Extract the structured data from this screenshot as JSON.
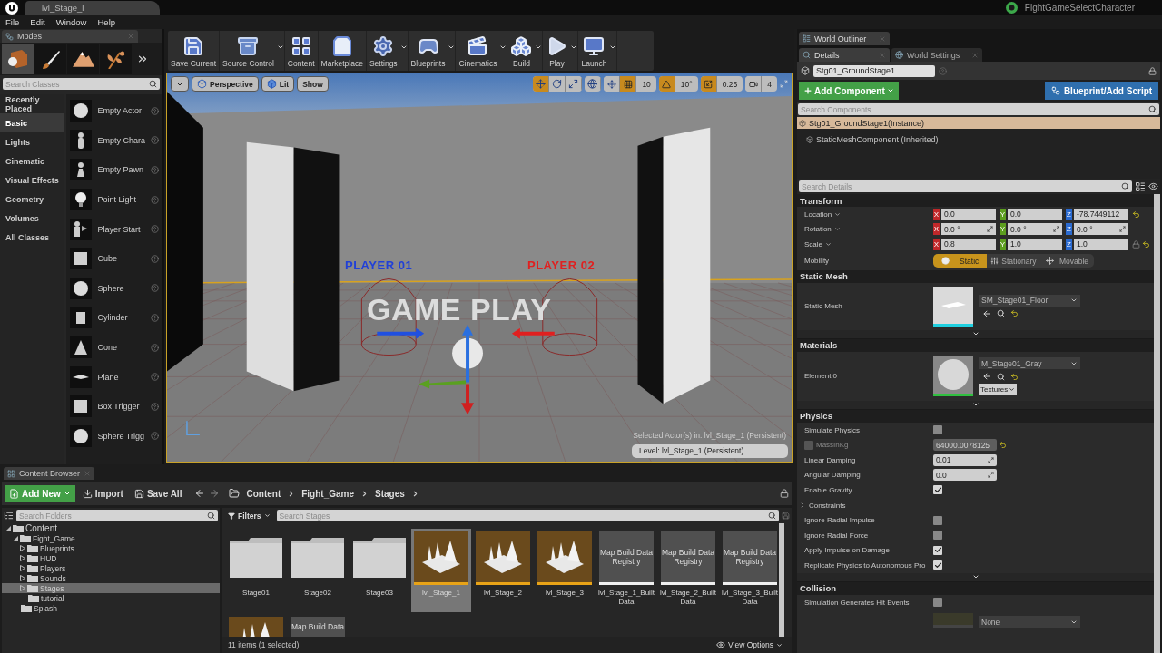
{
  "title_bar": {
    "document_tab": "lvl_Stage_l",
    "project": "FightGameSelectCharacter"
  },
  "menu": [
    "File",
    "Edit",
    "Window",
    "Help"
  ],
  "modes": {
    "tab": "Modes",
    "mode_tabs": [
      {
        "kind": "place",
        "selected": true
      },
      {
        "kind": "paint",
        "selected": false
      },
      {
        "kind": "landscape",
        "selected": false
      },
      {
        "kind": "foliage",
        "selected": false
      }
    ],
    "search_placeholder": "Search Classes",
    "categories": [
      {
        "label": "Recently Placed",
        "selected": false
      },
      {
        "label": "Basic",
        "selected": true
      },
      {
        "label": "Lights",
        "selected": false
      },
      {
        "label": "Cinematic",
        "selected": false
      },
      {
        "label": "Visual Effects",
        "selected": false
      },
      {
        "label": "Geometry",
        "selected": false
      },
      {
        "label": "Volumes",
        "selected": false
      },
      {
        "label": "All Classes",
        "selected": false
      }
    ],
    "items": [
      {
        "label": "Empty Actor",
        "kind": "sphere"
      },
      {
        "label": "Empty Chara",
        "kind": "figure"
      },
      {
        "label": "Empty Pawn",
        "kind": "pawn"
      },
      {
        "label": "Point Light",
        "kind": "bulb"
      },
      {
        "label": "Player Start",
        "kind": "start"
      },
      {
        "label": "Cube",
        "kind": "cube"
      },
      {
        "label": "Sphere",
        "kind": "sphere"
      },
      {
        "label": "Cylinder",
        "kind": "cylinder"
      },
      {
        "label": "Cone",
        "kind": "cone"
      },
      {
        "label": "Plane",
        "kind": "plane"
      },
      {
        "label": "Box Trigger",
        "kind": "cube"
      },
      {
        "label": "Sphere Trigg",
        "kind": "sphere"
      }
    ]
  },
  "toolbar": [
    {
      "label": "Save Current",
      "kind": "save",
      "dropdown": false
    },
    {
      "label": "Source Control",
      "kind": "source",
      "dropdown": true
    },
    {
      "label": "Content",
      "kind": "content",
      "dropdown": false
    },
    {
      "label": "Marketplace",
      "kind": "market",
      "dropdown": false
    },
    {
      "label": "Settings",
      "kind": "settings",
      "dropdown": true
    },
    {
      "label": "Blueprints",
      "kind": "blueprints",
      "dropdown": true
    },
    {
      "label": "Cinematics",
      "kind": "cinematics",
      "dropdown": true
    },
    {
      "label": "Build",
      "kind": "build",
      "dropdown": true
    },
    {
      "label": "Play",
      "kind": "play",
      "dropdown": true
    },
    {
      "label": "Launch",
      "kind": "launch",
      "dropdown": true
    }
  ],
  "viewport": {
    "view_buttons": [
      {
        "label": "Perspective",
        "kind": "perspective"
      },
      {
        "label": "Lit",
        "kind": "lit"
      },
      {
        "label": "Show",
        "kind": "show"
      }
    ],
    "transform_modes": [
      {
        "kind": "translate",
        "selected": true
      },
      {
        "kind": "rotate",
        "selected": false
      },
      {
        "kind": "scale",
        "selected": false
      }
    ],
    "grid_snap": "10",
    "rotation_snap": "10°",
    "scale_snap": "0.25",
    "camera_speed": "4",
    "scene_texts": [
      {
        "text": "PLAYER 01",
        "color": "#2040d8"
      },
      {
        "text": "PLAYER 02",
        "color": "#e02020"
      },
      {
        "text": "GAME PLAY",
        "color": "#dcdcdc"
      }
    ],
    "selected_info": "Selected Actor(s) in:  lvl_Stage_1 (Persistent)",
    "level": "Level:  lvl_Stage_1 (Persistent)"
  },
  "outliner_tab": "World Outliner",
  "details": {
    "tabs": [
      {
        "label": "Details",
        "selected": true
      },
      {
        "label": "World Settings",
        "selected": false
      }
    ],
    "actor_name": "Stg01_GroundStage1",
    "add_component": "Add Component",
    "blueprint": "Blueprint/Add Script",
    "search_components_placeholder": "Search Components",
    "components": [
      {
        "label": "Stg01_GroundStage1(Instance)",
        "selected": true
      },
      {
        "label": "StaticMeshComponent (Inherited)",
        "selected": false
      }
    ],
    "search_details_placeholder": "Search Details",
    "transform": {
      "title": "Transform",
      "rows": [
        {
          "label": "Location",
          "kind": "location",
          "fields": [
            {
              "axis": "X",
              "value": "0.0"
            },
            {
              "axis": "Y",
              "value": "0.0"
            },
            {
              "axis": "Z",
              "value": "-78.7449112"
            }
          ]
        },
        {
          "label": "Rotation",
          "kind": "rotation",
          "fields": [
            {
              "axis": "X",
              "value": "0.0 °"
            },
            {
              "axis": "Y",
              "value": "0.0 °"
            },
            {
              "axis": "Z",
              "value": "0.0 °"
            }
          ]
        },
        {
          "label": "Scale",
          "kind": "scale",
          "fields": [
            {
              "axis": "X",
              "value": "0.8"
            },
            {
              "axis": "Y",
              "value": "1.0"
            },
            {
              "axis": "Z",
              "value": "1.0"
            }
          ]
        }
      ],
      "mobility_label": "Mobility",
      "mobility": [
        {
          "label": "Static",
          "kind": "static",
          "selected": true
        },
        {
          "label": "Stationary",
          "kind": "stationary",
          "selected": false
        },
        {
          "label": "Movable",
          "kind": "movable",
          "selected": false
        }
      ]
    },
    "static_mesh": {
      "title": "Static Mesh",
      "label": "Static Mesh",
      "asset": "SM_Stage01_Floor"
    },
    "materials": {
      "title": "Materials",
      "label": "Element 0",
      "asset": "M_Stage01_Gray",
      "textures": "Textures"
    },
    "physics": {
      "title": "Physics",
      "rows": [
        {
          "kind": "check",
          "label": "Simulate Physics",
          "checked": false
        },
        {
          "kind": "mass",
          "label": "MassInKg",
          "checked": false,
          "value": "64000.0078125"
        },
        {
          "kind": "number",
          "label": "Linear Damping",
          "value": "0.01"
        },
        {
          "kind": "number",
          "label": "Angular Damping",
          "value": "0.0"
        },
        {
          "kind": "check",
          "label": "Enable Gravity",
          "checked": true
        },
        {
          "kind": "group",
          "label": "Constraints",
          "expanded": false
        },
        {
          "kind": "check",
          "label": "Ignore Radial Impulse",
          "checked": false
        },
        {
          "kind": "check",
          "label": "Ignore Radial Force",
          "checked": false
        },
        {
          "kind": "check",
          "label": "Apply Impulse on Damage",
          "checked": true
        },
        {
          "kind": "check",
          "label": "Replicate Physics to Autonomous Pro",
          "checked": true
        }
      ]
    },
    "collision": {
      "title": "Collision",
      "rows": [
        {
          "kind": "check",
          "label": "Simulation Generates Hit Events",
          "checked": false
        }
      ],
      "asset": "None"
    }
  },
  "content_browser": {
    "tab": "Content Browser",
    "add_new": "Add New",
    "import": "Import",
    "save_all": "Save All",
    "path": [
      "Content",
      "Fight_Game",
      "Stages"
    ],
    "search_folders_placeholder": "Search Folders",
    "tree": [
      {
        "label": "Content",
        "expanded": true,
        "selected": false,
        "children": [
          {
            "label": "Fight_Game",
            "expanded": true,
            "selected": false,
            "children": [
              {
                "label": "Blueprints",
                "expanded": false,
                "selected": false
              },
              {
                "label": "HUD",
                "expanded": false,
                "selected": false
              },
              {
                "label": "Players",
                "expanded": false,
                "selected": false
              },
              {
                "label": "Sounds",
                "expanded": false,
                "selected": false
              },
              {
                "label": "Stages",
                "expanded": false,
                "selected": true
              },
              {
                "label": "tutorial",
                "selected": false
              }
            ]
          },
          {
            "label": "Splash",
            "selected": false
          }
        ]
      }
    ],
    "filters": "Filters",
    "search_assets_placeholder": "Search Stages",
    "assets": [
      {
        "kind": "folder",
        "label": "Stage01",
        "selected": false
      },
      {
        "kind": "folder",
        "label": "Stage02",
        "selected": false
      },
      {
        "kind": "folder",
        "label": "Stage03",
        "selected": false
      },
      {
        "kind": "level",
        "label": "lvl_Stage_1",
        "selected": true
      },
      {
        "kind": "level",
        "label": "lvl_Stage_2",
        "selected": false
      },
      {
        "kind": "level",
        "label": "lvl_Stage_3",
        "selected": false
      },
      {
        "kind": "registry",
        "thumb_text": "Map Build Data Registry",
        "label": "lvl_Stage_1_Built Data",
        "selected": false
      },
      {
        "kind": "registry",
        "thumb_text": "Map Build Data Registry",
        "label": "lvl_Stage_2_Built Data",
        "selected": false
      },
      {
        "kind": "registry",
        "thumb_text": "Map Build Data Registry",
        "label": "lvl_Stage_3_Built Data",
        "selected": false
      },
      {
        "kind": "level",
        "selected": false
      },
      {
        "kind": "registry",
        "thumb_text": "Map Build Data",
        "selected": false
      }
    ],
    "status": "11 items (1 selected)",
    "view_options": "View Options"
  }
}
